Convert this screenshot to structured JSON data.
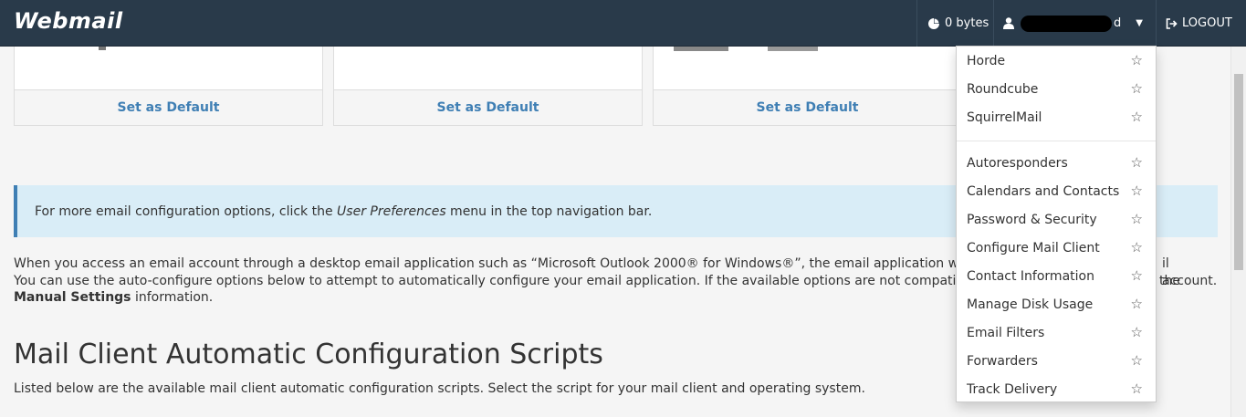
{
  "header": {
    "brand": "Webmail",
    "disk_usage": "0 bytes",
    "user_suffix": "d",
    "logout": "LOGOUT"
  },
  "cards": [
    {
      "action": "Set as Default"
    },
    {
      "action": "Set as Default"
    },
    {
      "action": "Set as Default"
    }
  ],
  "callout": {
    "prefix": "For more email configuration options, click the ",
    "emphasis": "User Preferences",
    "suffix": " menu in the top navigation bar."
  },
  "intro": {
    "line1": "When you access an email account through a desktop email application such as “Microsoft Outlook 2000® for Windows®”, the email application will require spe",
    "line1_end": "il account.",
    "line2": "You can use the auto-configure options below to attempt to automatically configure your email application. If the available options are not compatible with you",
    "line2_end": "the",
    "bold": "Manual Settings",
    "line3": " information."
  },
  "section": {
    "title": "Mail Client Automatic Configuration Scripts",
    "subtitle": "Listed below are the available mail client automatic configuration scripts. Select the script for your mail client and operating system."
  },
  "dropdown": {
    "webmail_apps": [
      "Horde",
      "Roundcube",
      "SquirrelMail"
    ],
    "tools": [
      "Autoresponders",
      "Calendars and Contacts",
      "Password & Security",
      "Configure Mail Client",
      "Contact Information",
      "Manage Disk Usage",
      "Email Filters",
      "Forwarders",
      "Track Delivery"
    ],
    "star_icon": "star-outline-icon"
  }
}
